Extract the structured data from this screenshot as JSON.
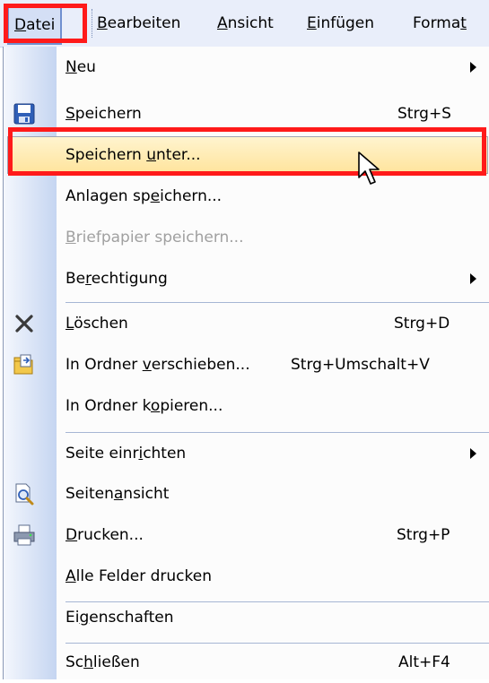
{
  "menubar": {
    "items": [
      {
        "pre": "",
        "u": "D",
        "post": "atei"
      },
      {
        "pre": "",
        "u": "B",
        "post": "earbeiten"
      },
      {
        "pre": "",
        "u": "A",
        "post": "nsicht"
      },
      {
        "pre": "",
        "u": "E",
        "post": "infügen"
      },
      {
        "pre": "Forma",
        "u": "t",
        "post": ""
      }
    ]
  },
  "menu": {
    "items": [
      {
        "pre": "",
        "u": "N",
        "post": "eu",
        "shortcut": "",
        "submenu": true
      },
      {
        "pre": "",
        "u": "S",
        "post": "peichern",
        "shortcut": "Strg+S",
        "icon": "floppy-disk-icon"
      },
      {
        "pre": "Speichern ",
        "u": "u",
        "post": "nter...",
        "shortcut": "",
        "highlighted": true
      },
      {
        "pre": "Anlagen sp",
        "u": "e",
        "post": "ichern...",
        "shortcut": ""
      },
      {
        "pre": "",
        "u": "B",
        "post": "riefpapier speichern...",
        "shortcut": "",
        "disabled": true
      },
      {
        "pre": "Be",
        "u": "r",
        "post": "echtigung",
        "shortcut": "",
        "submenu": true
      },
      {
        "pre": "",
        "u": "L",
        "post": "öschen",
        "shortcut": "Strg+D",
        "icon": "delete-x-icon"
      },
      {
        "pre": "In Ordner ",
        "u": "v",
        "post": "erschieben...",
        "shortcut": "Strg+Umschalt+V",
        "icon": "move-to-folder-icon"
      },
      {
        "pre": "In Ordner k",
        "u": "o",
        "post": "pieren...",
        "shortcut": ""
      },
      {
        "pre": "Seite einr",
        "u": "i",
        "post": "chten",
        "shortcut": "",
        "submenu": true
      },
      {
        "pre": "Seiten",
        "u": "a",
        "post": "nsicht",
        "shortcut": "",
        "icon": "print-preview-icon"
      },
      {
        "pre": "",
        "u": "D",
        "post": "rucken...",
        "shortcut": "Strg+P",
        "icon": "printer-icon"
      },
      {
        "pre": "",
        "u": "A",
        "post": "lle Felder drucken",
        "shortcut": ""
      },
      {
        "pre": "Ei",
        "u": "g",
        "post": "enschaften",
        "shortcut": ""
      },
      {
        "pre": "Sc",
        "u": "h",
        "post": "ließen",
        "shortcut": "Alt+F4"
      }
    ]
  },
  "colors": {
    "highlight": "#ffe49c",
    "annotation": "#ff1a1a",
    "gutter": "#c5d5f1"
  }
}
